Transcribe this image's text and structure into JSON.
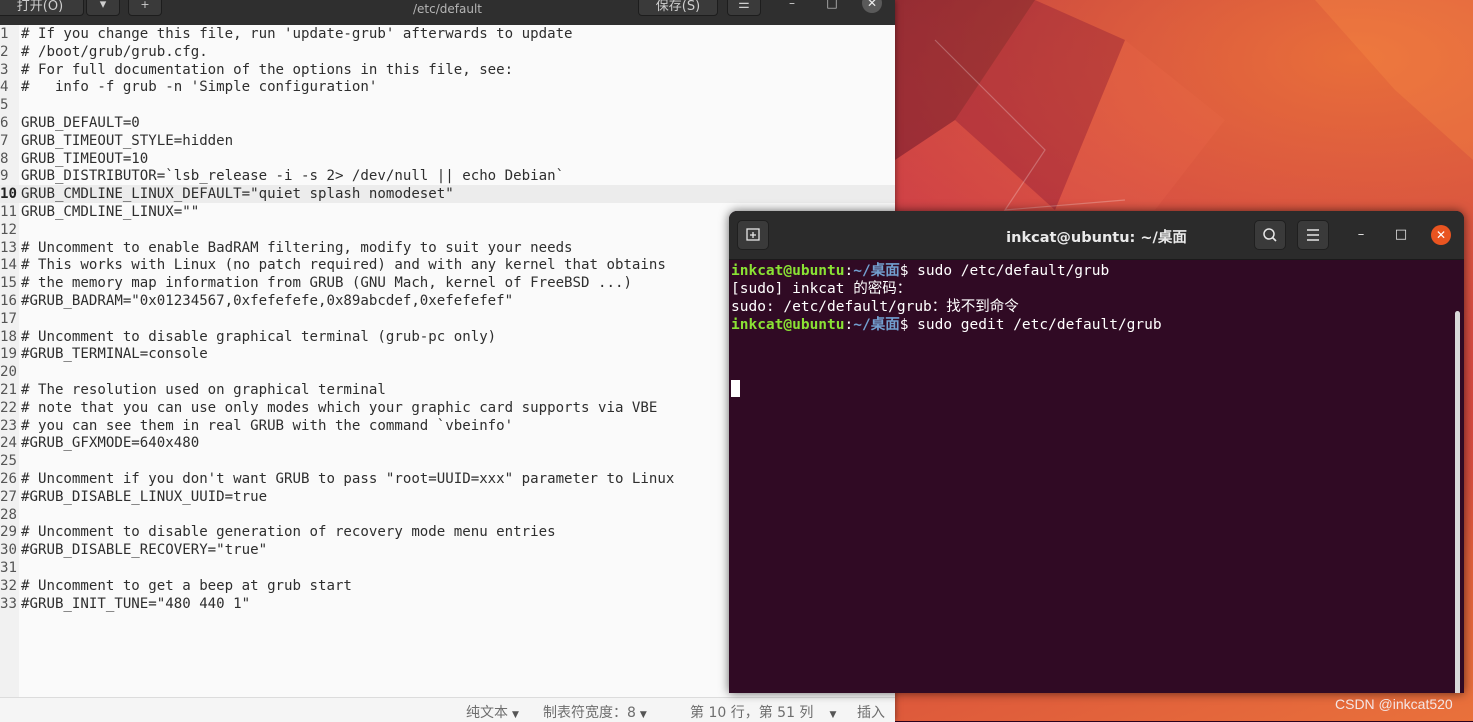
{
  "gedit": {
    "open_label": "打开(O)",
    "new_tab_icon": "new-tab-icon",
    "title": "/etc/default",
    "save_label": "保存(S)",
    "menu_icon": "hamburger-icon",
    "lines": [
      {
        "n": "1",
        "text": "# If you change this file, run 'update-grub' afterwards to update"
      },
      {
        "n": "2",
        "text": "# /boot/grub/grub.cfg."
      },
      {
        "n": "3",
        "text": "# For full documentation of the options in this file, see:"
      },
      {
        "n": "4",
        "text": "#   info -f grub -n 'Simple configuration'"
      },
      {
        "n": "5",
        "text": ""
      },
      {
        "n": "6",
        "text": "GRUB_DEFAULT=0"
      },
      {
        "n": "7",
        "text": "GRUB_TIMEOUT_STYLE=hidden"
      },
      {
        "n": "8",
        "text": "GRUB_TIMEOUT=10"
      },
      {
        "n": "9",
        "text": "GRUB_DISTRIBUTOR=`lsb_release -i -s 2> /dev/null || echo Debian`"
      },
      {
        "n": "10",
        "text": "GRUB_CMDLINE_LINUX_DEFAULT=\"quiet splash nomodeset\"",
        "current": true
      },
      {
        "n": "11",
        "text": "GRUB_CMDLINE_LINUX=\"\""
      },
      {
        "n": "12",
        "text": ""
      },
      {
        "n": "13",
        "text": "# Uncomment to enable BadRAM filtering, modify to suit your needs"
      },
      {
        "n": "14",
        "text": "# This works with Linux (no patch required) and with any kernel that obtains"
      },
      {
        "n": "15",
        "text": "# the memory map information from GRUB (GNU Mach, kernel of FreeBSD ...)"
      },
      {
        "n": "16",
        "text": "#GRUB_BADRAM=\"0x01234567,0xfefefefe,0x89abcdef,0xefefefef\""
      },
      {
        "n": "17",
        "text": ""
      },
      {
        "n": "18",
        "text": "# Uncomment to disable graphical terminal (grub-pc only)"
      },
      {
        "n": "19",
        "text": "#GRUB_TERMINAL=console"
      },
      {
        "n": "20",
        "text": ""
      },
      {
        "n": "21",
        "text": "# The resolution used on graphical terminal"
      },
      {
        "n": "22",
        "text": "# note that you can use only modes which your graphic card supports via VBE"
      },
      {
        "n": "23",
        "text": "# you can see them in real GRUB with the command `vbeinfo'"
      },
      {
        "n": "24",
        "text": "#GRUB_GFXMODE=640x480"
      },
      {
        "n": "25",
        "text": ""
      },
      {
        "n": "26",
        "text": "# Uncomment if you don't want GRUB to pass \"root=UUID=xxx\" parameter to Linux"
      },
      {
        "n": "27",
        "text": "#GRUB_DISABLE_LINUX_UUID=true"
      },
      {
        "n": "28",
        "text": ""
      },
      {
        "n": "29",
        "text": "# Uncomment to disable generation of recovery mode menu entries"
      },
      {
        "n": "30",
        "text": "#GRUB_DISABLE_RECOVERY=\"true\""
      },
      {
        "n": "31",
        "text": ""
      },
      {
        "n": "32",
        "text": "# Uncomment to get a beep at grub start"
      },
      {
        "n": "33",
        "text": "#GRUB_INIT_TUNE=\"480 440 1\""
      }
    ],
    "status": {
      "language": "纯文本",
      "tab_width": "制表符宽度：8",
      "position": "第 10 行，第 51 列",
      "insert_mode": "插入"
    }
  },
  "terminal": {
    "title": "inkcat@ubuntu: ~/桌面",
    "prompt_user": "inkcat@ubuntu",
    "prompt_sep": ":",
    "prompt_path": "~/桌面",
    "lines": [
      {
        "type": "prompt",
        "cmd": "$ sudo /etc/default/grub"
      },
      {
        "type": "output",
        "text": "[sudo] inkcat 的密码："
      },
      {
        "type": "output",
        "text": "sudo: /etc/default/grub：找不到命令"
      },
      {
        "type": "prompt",
        "cmd": "$ sudo gedit /etc/default/grub"
      }
    ]
  },
  "watermark": "CSDN @inkcat520",
  "colors": {
    "terminal_bg": "#300a24",
    "prompt_user": "#8ae234",
    "prompt_path": "#729fcf",
    "close_button": "#e95420"
  }
}
